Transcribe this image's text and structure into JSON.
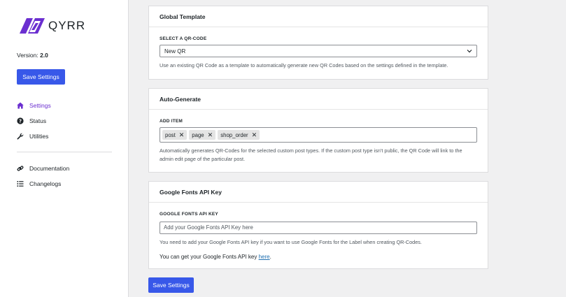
{
  "brand": {
    "name": "QYRR",
    "accent": "#6b2fd0"
  },
  "version": {
    "label": "Version:",
    "value": "2.0"
  },
  "sidebar": {
    "save_label": "Save Settings",
    "primary_nav": [
      {
        "label": "Settings",
        "icon": "home-icon",
        "active": true
      },
      {
        "label": "Status",
        "icon": "question-icon",
        "active": false
      },
      {
        "label": "Utilities",
        "icon": "wrench-icon",
        "active": false
      }
    ],
    "secondary_nav": [
      {
        "label": "Documentation",
        "icon": "link-icon"
      },
      {
        "label": "Changelogs",
        "icon": "list-icon"
      }
    ]
  },
  "global_template": {
    "title": "Global Template",
    "field_label": "SELECT A QR-CODE",
    "selected": "New QR",
    "description": "Use an existing QR Code as a template to automatically generate new QR Codes based on the settings defined in the template."
  },
  "auto_generate": {
    "title": "Auto-Generate",
    "field_label": "ADD ITEM",
    "tags": [
      "post",
      "page",
      "shop_order"
    ],
    "description": "Automatically generates QR-Codes for the selected custom post types. If the custom post type isn't public, the QR Code will link to the admin edit page of the particular post."
  },
  "google_fonts": {
    "title": "Google Fonts API Key",
    "field_label": "GOOGLE FONTS API KEY",
    "value": "",
    "placeholder": "Add your Google Fonts API Key here",
    "description": "You need to add your Google Fonts API key if you want to use Google Fonts for the Label when creating QR-Codes.",
    "note_prefix": "You can get your Google Fonts API key",
    "note_link": "here",
    "note_suffix": "."
  },
  "main": {
    "save_label": "Save Settings"
  },
  "colors": {
    "button": "#3858e9",
    "link": "#2271b1",
    "background": "#f0f0f1"
  }
}
